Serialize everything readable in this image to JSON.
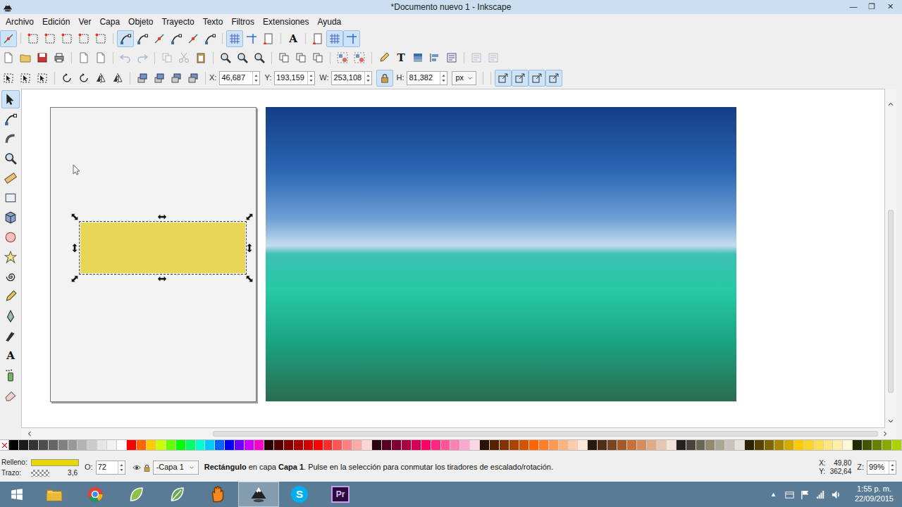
{
  "window": {
    "title": "*Documento nuevo 1 - Inkscape",
    "controls": [
      "—",
      "❐",
      "✕"
    ]
  },
  "menu": [
    "Archivo",
    "Edición",
    "Ver",
    "Capa",
    "Objeto",
    "Trayecto",
    "Texto",
    "Filtros",
    "Extensiones",
    "Ayuda"
  ],
  "snap_toolbar": [
    [
      {
        "pressed": true
      }
    ],
    [
      {
        "pressed": false
      },
      {
        "pressed": false
      },
      {
        "pressed": false
      },
      {
        "pressed": false
      },
      {
        "pressed": false
      }
    ],
    [
      {
        "pressed": true
      },
      {
        "pressed": false
      },
      {
        "pressed": false
      },
      {
        "pressed": false
      },
      {
        "pressed": false
      },
      {
        "pressed": false
      }
    ],
    [
      {
        "pressed": true
      },
      {
        "pressed": false
      },
      {
        "pressed": false
      }
    ],
    [
      {
        "pressed": false,
        "glyph": "A"
      }
    ],
    [
      {
        "pressed": false
      },
      {
        "pressed": true
      },
      {
        "pressed": true
      }
    ]
  ],
  "commands_toolbar": [
    [
      {
        "disabled": false
      },
      {
        "disabled": false
      },
      {
        "disabled": false
      },
      {
        "disabled": false
      }
    ],
    [
      {
        "disabled": false
      },
      {
        "disabled": false
      }
    ],
    [
      {
        "disabled": true
      },
      {
        "disabled": true
      }
    ],
    [
      {
        "disabled": true
      },
      {
        "disabled": true
      },
      {
        "disabled": false
      }
    ],
    [
      {
        "disabled": false
      },
      {
        "disabled": false
      },
      {
        "disabled": false
      }
    ],
    [
      {
        "disabled": false
      },
      {
        "disabled": false
      },
      {
        "disabled": false
      }
    ],
    [
      {
        "disabled": false
      },
      {
        "disabled": false
      }
    ],
    [
      {
        "disabled": false
      },
      {
        "disabled": false,
        "glyph": "T"
      },
      {
        "disabled": false
      },
      {
        "disabled": false
      },
      {
        "disabled": false
      }
    ],
    [
      {
        "disabled": true
      },
      {
        "disabled": true
      }
    ]
  ],
  "tool_controls": {
    "buttons": [
      [
        {
          "pressed": false
        },
        {
          "pressed": false
        },
        {
          "pressed": false
        }
      ],
      [
        {
          "pressed": false
        },
        {
          "pressed": false
        },
        {
          "pressed": false
        },
        {
          "pressed": false
        }
      ],
      [
        {
          "pressed": false
        },
        {
          "pressed": false
        },
        {
          "pressed": false
        },
        {
          "pressed": false
        }
      ]
    ],
    "fields": [
      {
        "label": "X:",
        "value": "46,687"
      },
      {
        "label": "Y:",
        "value": "193,159"
      },
      {
        "label": "W:",
        "value": "253,108"
      },
      {
        "label": "H:",
        "value": "81,382"
      }
    ],
    "locked": true,
    "unit": "px",
    "toggles": [
      [
        {
          "pressed": true
        },
        {
          "pressed": true
        },
        {
          "pressed": true
        },
        {
          "pressed": true
        }
      ]
    ]
  },
  "tools": [
    {
      "selected": true
    },
    {
      "selected": false
    },
    {
      "selected": false
    },
    {
      "selected": false
    },
    {
      "selected": false
    },
    {
      "selected": false
    },
    {
      "selected": false
    },
    {
      "selected": false
    },
    {
      "selected": false
    },
    {
      "selected": false
    },
    {
      "selected": false
    },
    {
      "selected": false
    },
    {
      "selected": false
    },
    {
      "selected": false,
      "glyph": "A"
    },
    {
      "selected": false
    },
    {
      "selected": false
    }
  ],
  "canvas": {
    "object_selected": true
  },
  "palette": {
    "colors": [
      "#000000",
      "#1a1a1a",
      "#333333",
      "#4d4d4d",
      "#666666",
      "#808080",
      "#999999",
      "#b3b3b3",
      "#cccccc",
      "#e6e6e6",
      "#f2f2f2",
      "#ffffff",
      "#ff0000",
      "#ff6600",
      "#ffcc00",
      "#ccff00",
      "#66ff00",
      "#00ff00",
      "#00ff66",
      "#00ffcc",
      "#00ccff",
      "#0066ff",
      "#0000ff",
      "#6600ff",
      "#cc00ff",
      "#ff00cc",
      "#2b0000",
      "#550000",
      "#800000",
      "#aa0000",
      "#d40000",
      "#ff0000",
      "#ff2a2a",
      "#ff5555",
      "#ff8080",
      "#ffaaaa",
      "#ffd5d5",
      "#2b0011",
      "#550022",
      "#800033",
      "#aa0044",
      "#d40055",
      "#ff0066",
      "#ff2a7f",
      "#ff5599",
      "#ff80b2",
      "#ffaacc",
      "#ffd5e5",
      "#2b1100",
      "#552200",
      "#803300",
      "#aa4400",
      "#d45500",
      "#ff6600",
      "#ff7f2a",
      "#ff9955",
      "#ffb380",
      "#ffccaa",
      "#ffe6d5",
      "#28170b",
      "#502d16",
      "#784421",
      "#a05a2c",
      "#c87137",
      "#d38d5f",
      "#deaa87",
      "#e9c6af",
      "#f4e3d7",
      "#24221c",
      "#48443a",
      "#6c6753",
      "#918a6f",
      "#aca793",
      "#c8c4b7",
      "#e3e2db",
      "#2b2200",
      "#554400",
      "#806600",
      "#aa8800",
      "#d4aa00",
      "#ffcc00",
      "#ffd42a",
      "#ffdd55",
      "#ffe680",
      "#ffeeaa",
      "#fff6d5",
      "#222b00",
      "#445500",
      "#668000",
      "#88aa00",
      "#aad400"
    ]
  },
  "status": {
    "fill_label": "Relleno:",
    "stroke_label": "Trazo:",
    "stroke_width": "3,6",
    "opacity_label": "O:",
    "opacity": "72",
    "layer": "-Capa 1",
    "message": [
      {
        "text": "Rectángulo",
        "bold": true
      },
      {
        "text": " en capa ",
        "bold": false
      },
      {
        "text": "Capa 1",
        "bold": true
      },
      {
        "text": ". Pulse en la selección para conmutar los tiradores de escalado/rotación.",
        "bold": false
      }
    ],
    "cursor_x_label": "X:",
    "cursor_x": "49,80",
    "cursor_y_label": "Y:",
    "cursor_y": "362,64",
    "zoom_label": "Z:",
    "zoom": "99%"
  },
  "taskbar": {
    "apps": [
      {
        "selected": false
      },
      {
        "selected": false
      },
      {
        "selected": false
      },
      {
        "selected": false
      },
      {
        "selected": false
      },
      {
        "selected": true
      },
      {
        "selected": false,
        "glyph": "S"
      },
      {
        "selected": false,
        "glyph": "Pr"
      }
    ],
    "tray_arrow": "▲",
    "time": "1:55 p. m.",
    "date": "22/09/2015"
  }
}
